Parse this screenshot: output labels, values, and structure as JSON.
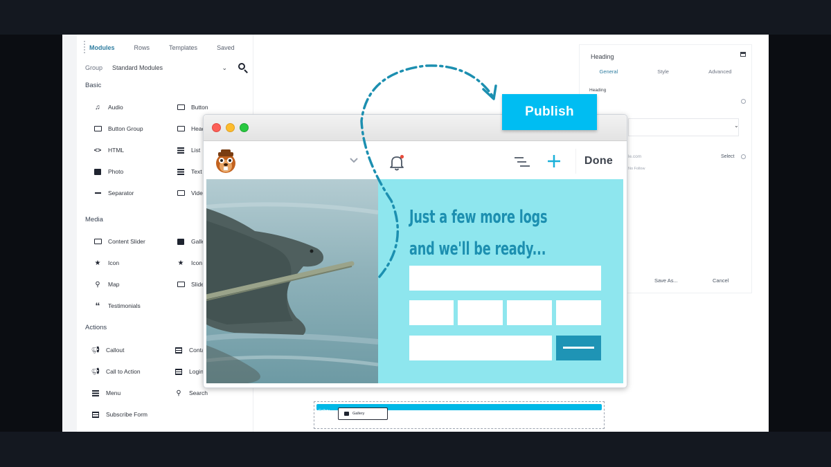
{
  "module_panel": {
    "tabs": [
      {
        "label": "Modules",
        "active": true
      },
      {
        "label": "Rows",
        "active": false
      },
      {
        "label": "Templates",
        "active": false
      },
      {
        "label": "Saved",
        "active": false
      }
    ],
    "group_label": "Group",
    "group_value": "Standard Modules",
    "sections": {
      "basic": "Basic",
      "media": "Media",
      "actions": "Actions"
    },
    "basic_modules": [
      "Audio",
      "Button",
      "Button Group",
      "Head",
      "HTML",
      "List",
      "Photo",
      "Text",
      "Separator",
      "Vide"
    ],
    "media_modules": [
      "Content Slider",
      "Galle",
      "Icon",
      "Icon",
      "Map",
      "Slide",
      "Testimonials"
    ],
    "action_modules": [
      "Callout",
      "Conta",
      "Call to Action",
      "Login",
      "Menu",
      "Search",
      "Subscribe Form"
    ]
  },
  "settings_panel": {
    "title": "Heading",
    "tabs": [
      "General",
      "Style",
      "Advanced"
    ],
    "field_label": "Heading",
    "link_placeholder": "le.com",
    "select_label": "Select",
    "no_follow": "No Follow",
    "save_as": "Save As...",
    "cancel": "Cancel"
  },
  "browser": {
    "done_label": "Done",
    "promo_line1": "Just a few more logs",
    "promo_line2": "and we'll be ready..."
  },
  "publish_label": "Publish",
  "gallery": {
    "bar_label": "Gallery",
    "chip_label": "Gallery"
  },
  "colors": {
    "accent": "#00bdf2",
    "promo_bg": "#8ee6ee",
    "promo_text": "#1c8fb0",
    "arrow": "#1c8fb0"
  }
}
